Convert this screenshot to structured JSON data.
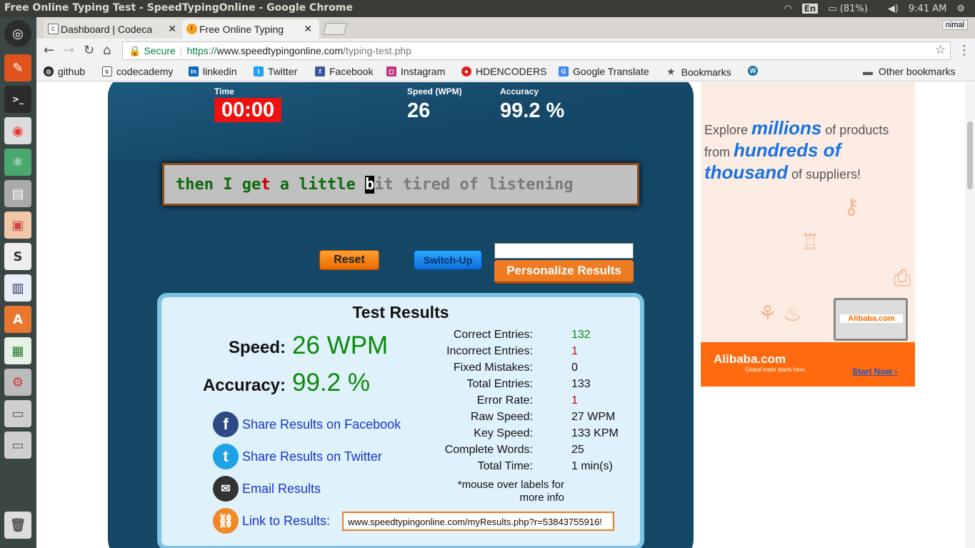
{
  "window": {
    "title": "Free Online Typing Test - SpeedTypingOnline - Google Chrome"
  },
  "system": {
    "lang": "En",
    "battery": "(81%)",
    "time": "9:41 AM"
  },
  "tabs": [
    {
      "label": "Dashboard | Codeca",
      "icon": "codecademy-icon"
    },
    {
      "label": "Free Online Typing",
      "icon": "speedtyping-icon"
    }
  ],
  "user": "nimal",
  "address": {
    "secure": "Secure",
    "scheme": "https://",
    "host": "www.speedtypingonline.com",
    "path": "/typing-test.php"
  },
  "bookmarks": [
    "github",
    "codecademy",
    "linkedin",
    "Twitter",
    "Facebook",
    "Instagram",
    "HDENCODERS",
    "Google Translate",
    "Bookmarks",
    "Other bookmarks"
  ],
  "test": {
    "time_label": "Time",
    "time": "00:00",
    "speed_label": "Speed (WPM)",
    "speed": "26",
    "accuracy_label": "Accuracy",
    "accuracy": "99.2 %"
  },
  "typing": {
    "line": "then I get a little bit tired of listening"
  },
  "buttons": {
    "reset": "Reset",
    "switch": "Switch-Up",
    "personalize": "Personalize Results"
  },
  "results": {
    "title": "Test Results",
    "speed_label": "Speed:",
    "speed": "26 WPM",
    "accuracy_label": "Accuracy:",
    "accuracy": "99.2 %",
    "stats": [
      {
        "k": "Correct Entries:",
        "v": "132",
        "c": "#0a8a0a"
      },
      {
        "k": "Incorrect Entries:",
        "v": "1",
        "c": "#d00000"
      },
      {
        "k": "Fixed Mistakes:",
        "v": "0",
        "c": "#111111"
      },
      {
        "k": "Total Entries:",
        "v": "133",
        "c": "#111111"
      },
      {
        "k": "Error Rate:",
        "v": "1",
        "c": "#d00000"
      },
      {
        "k": "Raw Speed:",
        "v": "27 WPM",
        "c": "#111111"
      },
      {
        "k": "Key Speed:",
        "v": "133 KPM",
        "c": "#111111"
      },
      {
        "k": "Complete Words:",
        "v": "25",
        "c": "#111111"
      },
      {
        "k": "Total Time:",
        "v": "1 min(s)",
        "c": "#111111"
      }
    ],
    "note": "*mouse over labels for more info",
    "share_facebook": "Share Results on Facebook",
    "share_twitter": "Share Results on Twitter",
    "email": "Email Results",
    "link_label": "Link to Results:",
    "link": "www.speedtypingonline.com/myResults.php?r=53843755916!"
  },
  "ad": {
    "l1a": "Explore ",
    "l1b": "millions",
    "l1c": " of products",
    "l2a": "from ",
    "l2b": "hundreds of thousand",
    "l2c": " of suppliers!",
    "brand": "Alibaba.com",
    "tagline": "Global trade starts here.",
    "cta": "Start Now"
  }
}
